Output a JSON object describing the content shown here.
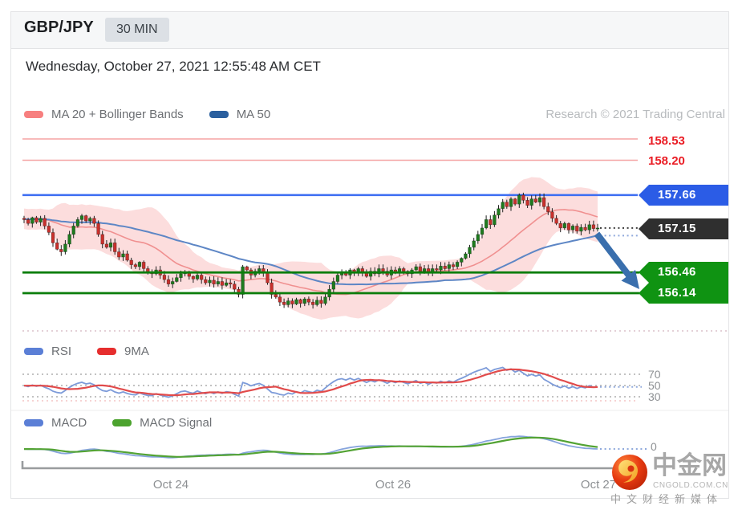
{
  "header": {
    "symbol": "GBP/JPY",
    "timeframe": "30 MIN",
    "timestamp": "Wednesday, October 27, 2021 12:55:48 AM CET",
    "research_credit": "Research © 2021 Trading Central"
  },
  "legends": {
    "main": [
      {
        "label": "MA 20 + Bollinger Bands",
        "color": "#f77f7f"
      },
      {
        "label": "MA 50",
        "color": "#2a5f9e"
      }
    ],
    "rsi": [
      {
        "label": "RSI",
        "color": "#5b7fd6"
      },
      {
        "label": "9MA",
        "color": "#e62e2e"
      }
    ],
    "macd": [
      {
        "label": "MACD",
        "color": "#5b7fd6"
      },
      {
        "label": "MACD Signal",
        "color": "#4ca32e"
      }
    ]
  },
  "levels": {
    "resistance": [
      {
        "value": "158.53"
      },
      {
        "value": "158.20"
      }
    ],
    "breakout": {
      "value": "157.66"
    },
    "last_price": {
      "value": "157.15"
    },
    "support": [
      {
        "value": "156.46"
      },
      {
        "value": "156.14"
      }
    ]
  },
  "watermark": {
    "site_name": "中金网",
    "domain": "CNGOLD.COM.CN",
    "tagline": "中文财经新媒体"
  },
  "colors": {
    "up_candle": "#1e7b1e",
    "down_candle": "#c9302c",
    "wick": "#222222",
    "bollinger_fill": "rgba(246,150,150,0.32)",
    "ma20": "#f09090",
    "ma50": "#5d86c5",
    "resistance_line": "#f5a3a3",
    "breakout_line": "#3d6ef2",
    "support_line": "#0b7d0b",
    "last_dotted": "#3a3a3a",
    "ma50_dotted": "#8fa9dc",
    "arrow": "#3a6fad",
    "rsi": "#7d9bd9",
    "rsi_ma": "#e14b4b",
    "macd": "#86a4dd",
    "macd_signal": "#53a334",
    "gridline": "#adadad",
    "badge_blue": "#2b5ce6",
    "badge_dark": "#2f2f2f",
    "badge_green": "#0f9312",
    "axis": "#999c9e"
  },
  "chart_data": [
    {
      "type": "candlestick",
      "title": "GBP/JPY 30 MIN with MA 20 + Bollinger Bands and MA 50",
      "x_axis": {
        "labels": [
          "Oct 24",
          "Oct 26",
          "Oct 27"
        ]
      },
      "ylim": [
        155.7,
        158.75
      ],
      "levels": {
        "resistance": [
          158.53,
          158.2
        ],
        "breakout": 157.66,
        "last_price": 157.15,
        "support": [
          156.46,
          156.14
        ]
      },
      "annotation": {
        "type": "down-arrow",
        "from_price": 157.15,
        "to_price": 156.14
      },
      "closes_warmup": [
        157.3,
        157.45,
        157.18,
        157.38,
        157.12,
        157.4,
        157.22,
        157.48,
        157.15,
        157.35,
        157.1,
        157.42,
        157.25,
        157.45,
        157.18,
        157.32,
        157.08,
        157.38,
        157.2,
        157.44,
        157.15,
        157.36,
        157.25,
        157.48,
        157.12,
        157.3,
        157.2,
        157.42,
        157.28,
        157.35,
        157.15,
        157.4,
        157.22,
        157.32,
        157.18,
        157.38,
        157.26,
        157.44,
        157.2,
        157.34,
        157.24,
        157.4,
        157.16,
        157.3,
        157.26,
        157.36,
        157.22,
        157.32,
        157.26,
        157.3
      ],
      "closes": [
        157.28,
        157.22,
        157.31,
        157.24,
        157.3,
        157.18,
        157.08,
        156.92,
        156.82,
        156.78,
        156.9,
        157.05,
        157.18,
        157.28,
        157.34,
        157.26,
        157.3,
        157.22,
        157.05,
        156.9,
        156.85,
        156.92,
        156.78,
        156.7,
        156.75,
        156.65,
        156.58,
        156.55,
        156.62,
        156.52,
        156.46,
        156.44,
        156.5,
        156.42,
        156.35,
        156.28,
        156.32,
        156.38,
        156.44,
        156.46,
        156.4,
        156.36,
        156.42,
        156.35,
        156.3,
        156.34,
        156.28,
        156.32,
        156.26,
        156.3,
        156.28,
        156.2,
        156.12,
        156.55,
        156.5,
        156.42,
        156.48,
        156.52,
        156.45,
        156.3,
        156.12,
        156.08,
        156.0,
        155.96,
        156.02,
        155.97,
        156.04,
        155.98,
        156.05,
        156.0,
        155.96,
        156.03,
        155.98,
        156.08,
        156.2,
        156.32,
        156.42,
        156.46,
        156.42,
        156.5,
        156.45,
        156.52,
        156.46,
        156.4,
        156.48,
        156.44,
        156.52,
        156.48,
        156.42,
        156.5,
        156.46,
        156.52,
        156.48,
        156.44,
        156.5,
        156.55,
        156.48,
        156.52,
        156.46,
        156.52,
        156.5,
        156.56,
        156.52,
        156.58,
        156.55,
        156.62,
        156.68,
        156.75,
        156.85,
        156.95,
        157.05,
        157.15,
        157.28,
        157.2,
        157.35,
        157.45,
        157.55,
        157.48,
        157.6,
        157.52,
        157.66,
        157.58,
        157.5,
        157.6,
        157.55,
        157.62,
        157.48,
        157.4,
        157.3,
        157.22,
        157.15,
        157.22,
        157.12,
        157.18,
        157.1,
        157.16,
        157.12,
        157.2,
        157.14,
        157.15
      ]
    },
    {
      "type": "line",
      "title": "RSI with 9MA",
      "gridlines": [
        70,
        50,
        30
      ],
      "gridline_labels": [
        "70",
        "50",
        "30"
      ],
      "periods": {
        "rsi": 14,
        "ma": 9
      }
    },
    {
      "type": "line",
      "title": "MACD with MACD Signal",
      "gridlines": [
        0
      ],
      "gridline_labels": [
        "0"
      ],
      "periods": {
        "fast": 12,
        "slow": 26,
        "signal": 9
      }
    }
  ]
}
